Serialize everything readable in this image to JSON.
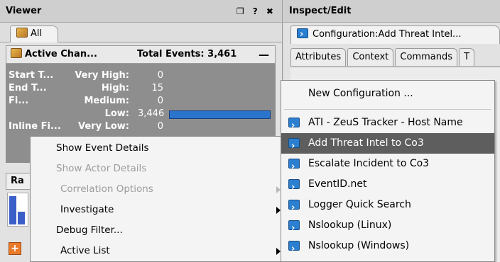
{
  "viewer": {
    "title": "Viewer",
    "controls": "❐ ? ✖",
    "tab_all": "All",
    "channel": {
      "name": "Active Chan...",
      "total_events": "Total Events: 3,461",
      "collapse": "—"
    },
    "stats": [
      {
        "label": "Start T...",
        "level": "Very High:",
        "count": "0"
      },
      {
        "label": "End T...",
        "level": "High:",
        "count": "15"
      },
      {
        "label": "Fi...",
        "level": "Medium:",
        "count": "0"
      },
      {
        "label": "",
        "level": "Low:",
        "count": "3,446"
      },
      {
        "label": "Inline Fi...",
        "level": "Very Low:",
        "count": "0"
      }
    ],
    "low_bar_fraction": 0.995,
    "radar_tab": "Ra"
  },
  "inspect": {
    "title": "Inspect/Edit",
    "config_tab": "Configuration:Add Threat Intel...",
    "subtabs": [
      "Attributes",
      "Context",
      "Commands",
      "T"
    ]
  },
  "context_menu": {
    "items": [
      {
        "label": "Show Event Details",
        "enabled": true
      },
      {
        "label": "Show Actor Details",
        "enabled": false
      },
      {
        "label": "Correlation Options",
        "enabled": false,
        "submenu": true
      },
      {
        "label": "Investigate",
        "enabled": true,
        "submenu": true
      },
      {
        "label": "Debug Filter...",
        "enabled": true
      },
      {
        "label": "Active List",
        "enabled": true,
        "submenu": true
      }
    ]
  },
  "sub_menu": {
    "items": [
      {
        "label": "New Configuration ...",
        "icon": ""
      },
      {
        "label": "ATI - ZeuS Tracker - Host Name",
        "icon": "terminal-icon"
      },
      {
        "label": "Add Threat Intel to Co3",
        "icon": "terminal-icon",
        "selected": true
      },
      {
        "label": "Escalate Incident to Co3",
        "icon": "terminal-icon"
      },
      {
        "label": "EventID.net",
        "icon": "terminal-icon"
      },
      {
        "label": "Logger Quick Search",
        "icon": "terminal-icon"
      },
      {
        "label": "Nslookup (Linux)",
        "icon": "terminal-icon"
      },
      {
        "label": "Nslookup (Windows)",
        "icon": "terminal-icon"
      }
    ]
  },
  "colors": {
    "selection": "#5e5e5e",
    "bar": "#2b74cc",
    "stats_bg": "#8e8e8e"
  }
}
